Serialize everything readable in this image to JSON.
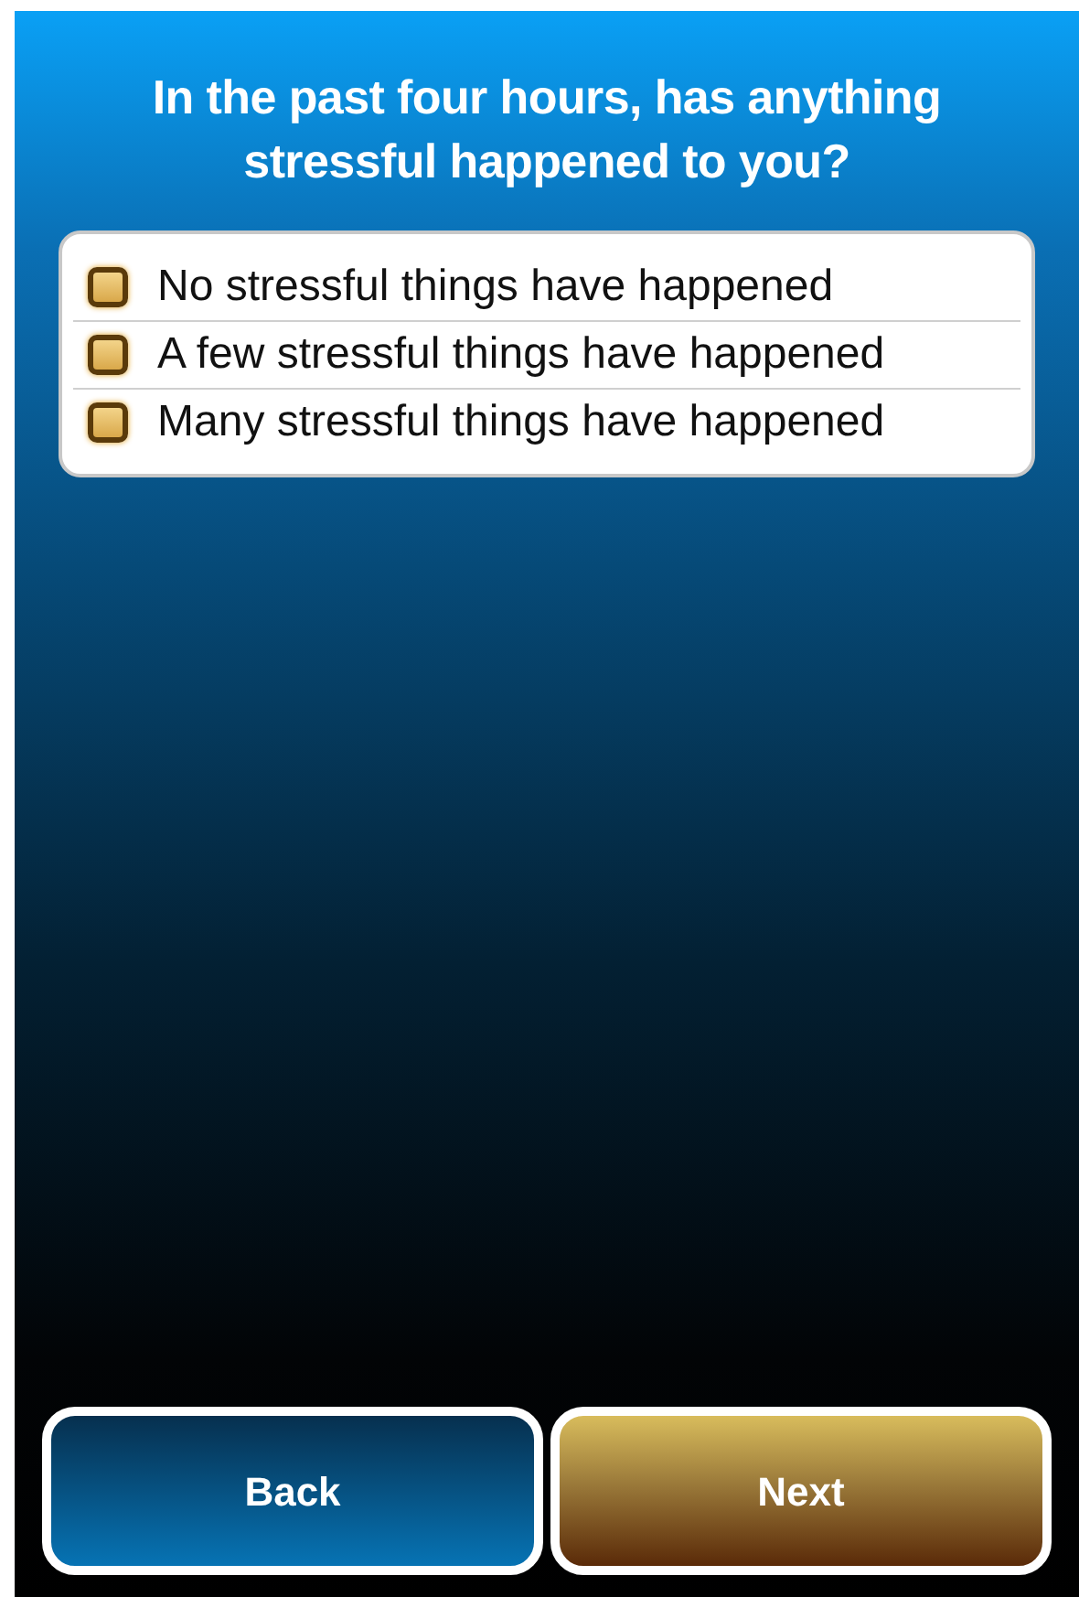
{
  "question": "In the past four hours, has anything stressful happened to you?",
  "options": [
    {
      "label": "No stressful things have happened",
      "checked": false
    },
    {
      "label": "A few stressful things have happened",
      "checked": false
    },
    {
      "label": "Many stressful things have happened",
      "checked": false
    }
  ],
  "buttons": [
    {
      "label": "Back",
      "kind": "back"
    },
    {
      "label": "Next",
      "kind": "next"
    }
  ]
}
